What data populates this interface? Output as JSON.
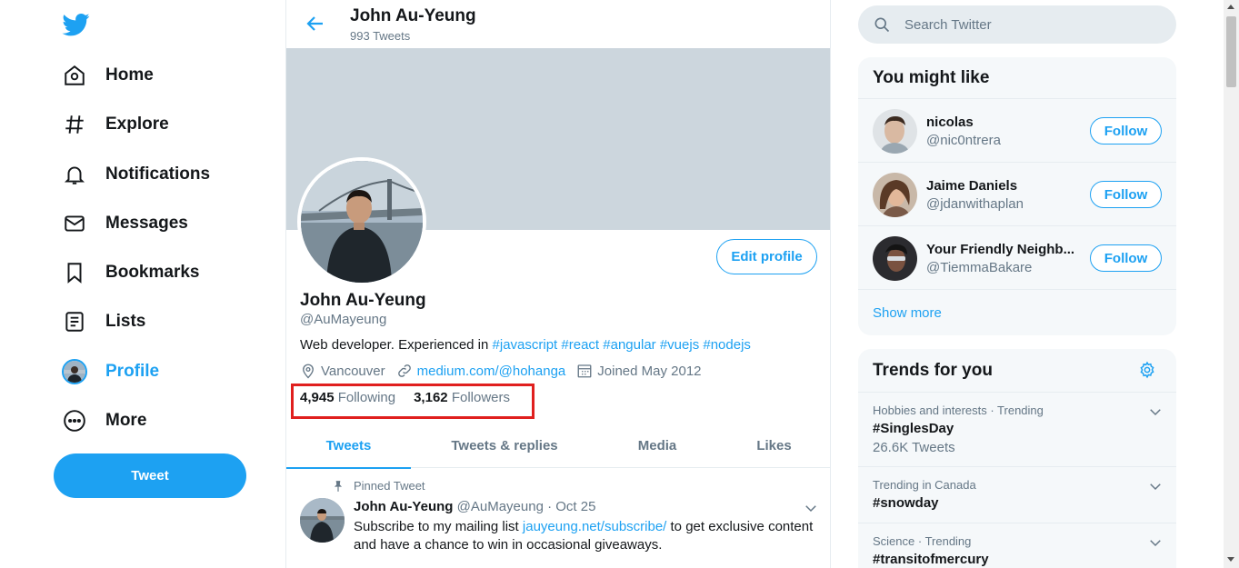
{
  "nav": {
    "items": [
      {
        "label": "Home",
        "icon": "home-icon"
      },
      {
        "label": "Explore",
        "icon": "hashtag-icon"
      },
      {
        "label": "Notifications",
        "icon": "bell-icon"
      },
      {
        "label": "Messages",
        "icon": "envelope-icon"
      },
      {
        "label": "Bookmarks",
        "icon": "bookmark-icon"
      },
      {
        "label": "Lists",
        "icon": "list-icon"
      },
      {
        "label": "Profile",
        "icon": "avatar",
        "active": true
      },
      {
        "label": "More",
        "icon": "more-icon"
      }
    ],
    "tweet_button": "Tweet"
  },
  "header": {
    "name": "John Au-Yeung",
    "tweet_count": "993 Tweets"
  },
  "profile": {
    "edit_button": "Edit profile",
    "name": "John Au-Yeung",
    "handle": "@AuMayeung",
    "bio_prefix": "Web developer. Experienced in",
    "bio_tags": [
      "#javascript",
      "#react",
      "#angular",
      "#vuejs",
      "#nodejs"
    ],
    "location": "Vancouver",
    "website": "medium.com/@hohanga",
    "joined": "Joined May 2012",
    "following_count": "4,945",
    "following_label": "Following",
    "followers_count": "3,162",
    "followers_label": "Followers"
  },
  "tabs": [
    "Tweets",
    "Tweets & replies",
    "Media",
    "Likes"
  ],
  "pinned_tweet": {
    "label": "Pinned Tweet",
    "author": "John Au-Yeung",
    "handle": "@AuMayeung",
    "separator": "·",
    "date": "Oct 25",
    "text_before": "Subscribe to my mailing list",
    "link": "jauyeung.net/subscribe/",
    "text_after": "to get exclusive content and have a chance to win in occasional giveaways."
  },
  "search": {
    "placeholder": "Search Twitter"
  },
  "who_to_follow": {
    "title": "You might like",
    "users": [
      {
        "name": "nicolas",
        "handle": "@nic0ntrera",
        "button": "Follow"
      },
      {
        "name": "Jaime Daniels",
        "handle": "@jdanwithaplan",
        "button": "Follow"
      },
      {
        "name": "Your Friendly Neighb...",
        "handle": "@TiemmaBakare",
        "button": "Follow"
      }
    ],
    "show_more": "Show more"
  },
  "trends": {
    "title": "Trends for you",
    "items": [
      {
        "category": "Hobbies and interests · Trending",
        "name": "#SinglesDay",
        "count": "26.6K Tweets"
      },
      {
        "category": "Trending in Canada",
        "name": "#snowday",
        "count": ""
      },
      {
        "category": "Science · Trending",
        "name": "#transitofmercury",
        "count": ""
      }
    ]
  },
  "colors": {
    "accent": "#1da1f2",
    "highlight_box": "#e0201e"
  }
}
